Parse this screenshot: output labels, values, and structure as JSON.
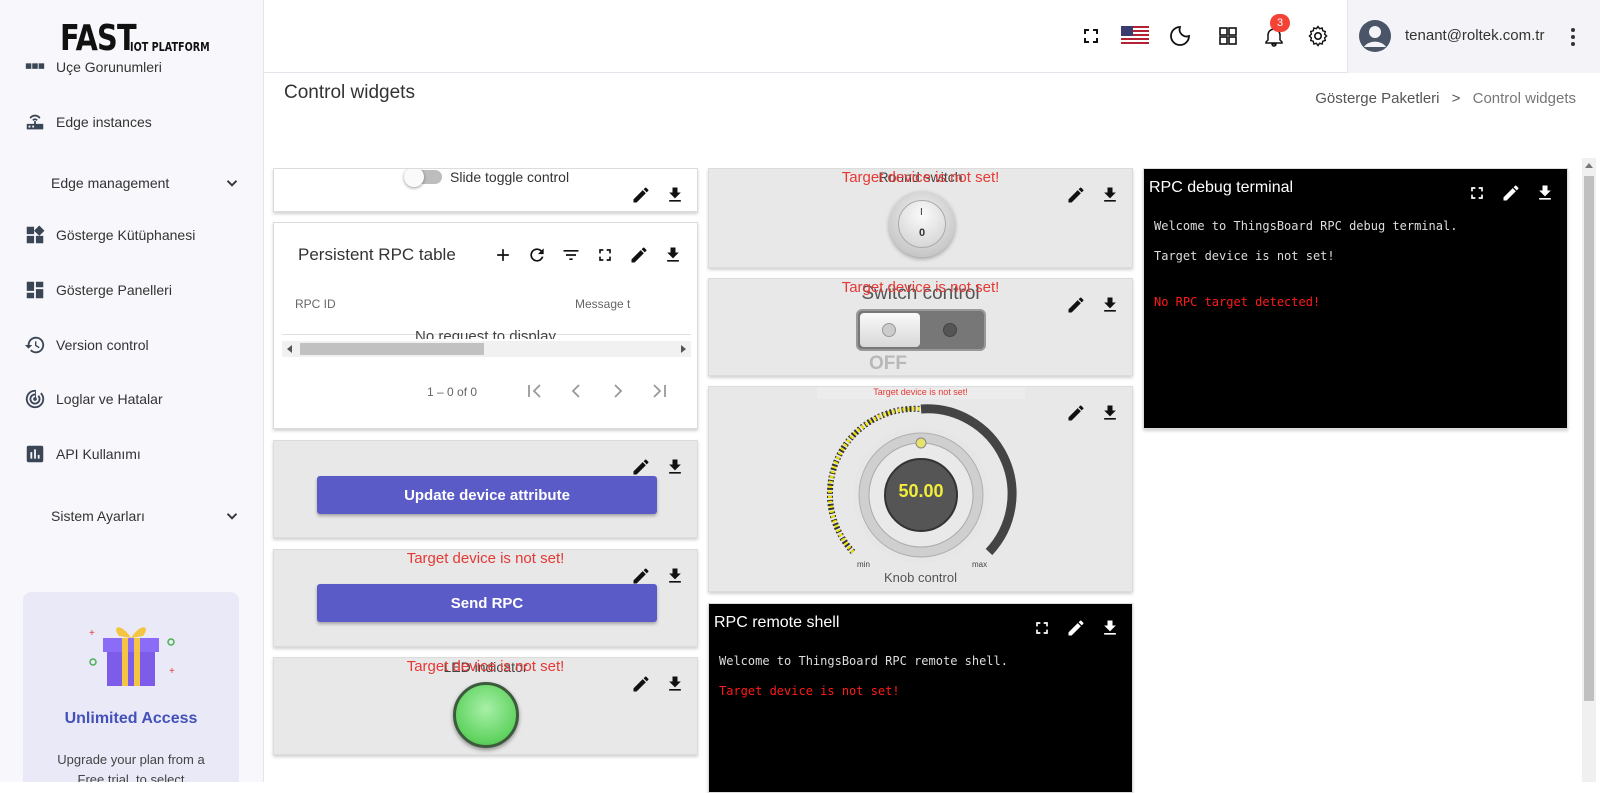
{
  "brand": {
    "logo_big": "FAST",
    "logo_small": "IOT PLATFORM"
  },
  "sidebar": {
    "partial_item": "Uçe Gorunumleri",
    "items": [
      {
        "label": "Edge instances",
        "icon": "router-icon"
      },
      {
        "label": "Edge management",
        "icon": "chevron-down-icon"
      },
      {
        "label": "Gösterge Kütüphanesi",
        "icon": "widgets-icon"
      },
      {
        "label": "Gösterge Panelleri",
        "icon": "dashboard-icon"
      },
      {
        "label": "Version control",
        "icon": "history-icon"
      },
      {
        "label": "Loglar ve Hatalar",
        "icon": "track-changes-icon"
      },
      {
        "label": "API Kullanımı",
        "icon": "insert-chart-icon"
      },
      {
        "label": "Sistem Ayarları",
        "icon": "chevron-down-icon"
      }
    ],
    "promo": {
      "title": "Unlimited Access",
      "text": "Upgrade your plan from a Free trial, to select"
    }
  },
  "topbar": {
    "notification_count": "3",
    "user_email": "tenant@roltek.com.tr"
  },
  "page": {
    "title": "Control widgets",
    "breadcrumb": [
      "Gösterge Paketleri",
      ">",
      "Control widgets"
    ]
  },
  "widgets": {
    "slide_toggle": {
      "label": "Slide toggle control"
    },
    "rpc_table": {
      "title": "Persistent RPC table",
      "columns": [
        "RPC ID",
        "Message t"
      ],
      "empty": "No request to display",
      "paging": "1 – 0 of 0"
    },
    "update_attr": {
      "button": "Update device attribute"
    },
    "send_rpc": {
      "error": "Target device is not set!",
      "button": "Send RPC"
    },
    "led": {
      "title": "LED indicator",
      "error": "Target device is not set!"
    },
    "round_switch": {
      "title": "Round switch",
      "error": "Target device is not set!",
      "on": "I",
      "off": "0"
    },
    "switch_control": {
      "title": "Switch control",
      "error": "Target device is not set!",
      "state": "OFF"
    },
    "knob": {
      "error": "Target device is not set!",
      "value": "50.00",
      "min": "min",
      "max": "max",
      "label": "Knob control"
    },
    "remote_shell": {
      "title": "RPC remote shell",
      "welcome": "Welcome to ThingsBoard RPC remote shell.",
      "error": "Target device is not set!"
    },
    "debug_terminal": {
      "title": "RPC debug terminal",
      "welcome": "Welcome to ThingsBoard RPC debug terminal.",
      "target": "Target device is not set!",
      "error": "No RPC target detected!"
    }
  },
  "colors": {
    "accent": "#5b5bc8",
    "error": "#e53935",
    "badge": "#f44336",
    "promo_title": "#4351b8"
  }
}
